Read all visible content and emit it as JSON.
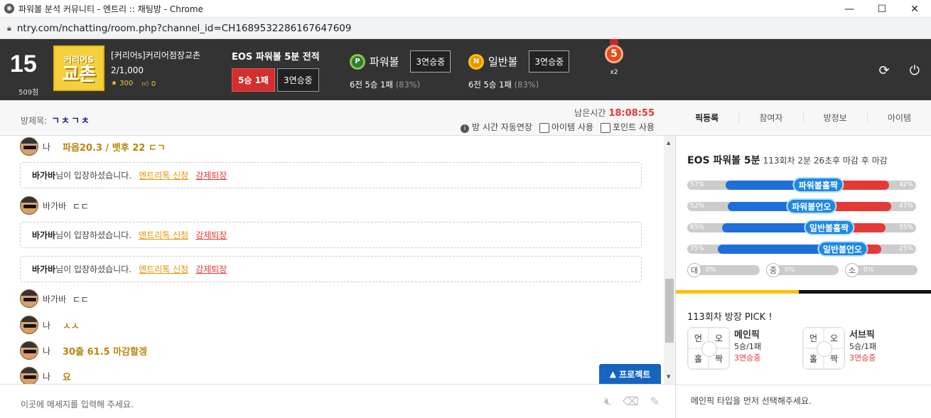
{
  "window": {
    "title": "파워볼 분석 커뮤니티 - 엔트리 :: 채팅방 - Chrome",
    "url": "ntry.com/nchatting/room.php?channel_id=CH1689532286167647609"
  },
  "profile": {
    "rank": "15",
    "points": "509점",
    "avatar_line1": "커리어S",
    "avatar_line2": "교촌",
    "name": "[커리어s]커리어점장교촌",
    "count": "2/1,000",
    "stars": "300",
    "likes": "0"
  },
  "eos": {
    "label": "EOS 파워볼 5분 전적",
    "record": "5승 1패",
    "streak": "3연승중"
  },
  "powerball": {
    "badge": "P",
    "name": "파워볼",
    "streak": "3연승중",
    "summary": "6전 5승 1패",
    "pct": "(83%)"
  },
  "normalball": {
    "badge": "N",
    "name": "일반볼",
    "streak": "3연승중",
    "summary": "6전 5승 1패",
    "pct": "(83%)"
  },
  "medal": {
    "num": "5",
    "mult": "x2"
  },
  "room": {
    "title_label": "방제목:",
    "title_value": "ㄱㅊㄱㅊ",
    "time_label": "남은시간",
    "time_value": "18:08:55",
    "auto_extend": "방 시간 자동연장",
    "item_use": "아이템 사용",
    "point_use": "포인트 사용"
  },
  "tabs": [
    "픽등록",
    "참여자",
    "방정보",
    "아이템"
  ],
  "messages": [
    {
      "nick": "나",
      "text": "파옵20.3 / 뱃후 22 ㄷㄱ"
    },
    {
      "nick": "바가바",
      "text": "ㄷㄷ"
    },
    {
      "nick": "바가바",
      "text": "ㄷㄷ"
    },
    {
      "nick": "나",
      "text": "ㅅㅅ"
    },
    {
      "nick": "나",
      "text": "30출 61.5 마감할겡"
    },
    {
      "nick": "나",
      "text": "요"
    }
  ],
  "notices": [
    {
      "user": "바가바",
      "text": "님이 입장하셨습니다.",
      "link1": "엔트리톡 신청",
      "link2": "강제퇴장"
    },
    {
      "user": "바가바",
      "text": "님이 입장하셨습니다.",
      "link1": "엔트리톡 신청",
      "link2": "강제퇴장"
    },
    {
      "user": "바가바",
      "text": "님이 입장하셨습니다.",
      "link1": "엔트리톡 신청",
      "link2": "강제퇴장"
    }
  ],
  "protect_label": "프로젝트",
  "input_placeholder": "이곳에 메세지를 입력해 주세요.",
  "right": {
    "game": "EOS 파워볼 5분",
    "round_info": "113회차 2분 26초후 마감 후 마감",
    "bars": [
      {
        "label": "파워볼홀짝",
        "left": "57%",
        "right": "42%",
        "left_val": 0.57
      },
      {
        "label": "파워볼언오",
        "left": "52%",
        "right": "47%",
        "left_val": 0.52
      },
      {
        "label": "일반볼홀짝",
        "left": "65%",
        "right": "35%",
        "left_val": 0.65
      },
      {
        "label": "일반볼언오",
        "left": "75%",
        "right": "25%",
        "left_val": 0.75
      }
    ],
    "sizes": [
      {
        "label": "대",
        "pct": "0%"
      },
      {
        "label": "중",
        "pct": "0%"
      },
      {
        "label": "소",
        "pct": "0%"
      }
    ],
    "pick_title": "113회차 방장 PICK !",
    "grid": [
      "언",
      "오",
      "홀",
      "짝"
    ],
    "main_pick": {
      "title": "메인픽",
      "record": "5승/1패",
      "streak": "3연승중"
    },
    "sub_pick": {
      "title": "서브픽",
      "record": "5승/1패",
      "streak": "3연승중"
    },
    "note": "메인픽 타입을 먼저 선택해주세요."
  },
  "colors": {
    "accent_red": "#e53935",
    "accent_blue": "#1e88e5",
    "gold": "#b8860b"
  }
}
